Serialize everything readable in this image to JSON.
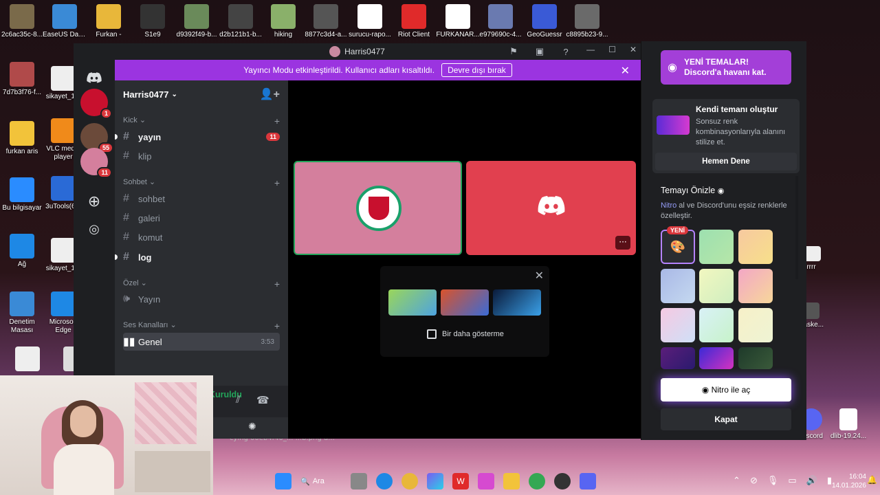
{
  "desktop": {
    "icons_top": [
      {
        "label": "2c6ac35c-8..."
      },
      {
        "label": "EaseUS Data Recovery"
      },
      {
        "label": "Furkan -"
      },
      {
        "label": "S1e9"
      },
      {
        "label": "d9392f49-b..."
      },
      {
        "label": "d2b121b1-b..."
      },
      {
        "label": "hiking"
      },
      {
        "label": "8877c3d4-a..."
      },
      {
        "label": "surucu-rapo..."
      },
      {
        "label": "Riot Client"
      },
      {
        "label": "FURKANAR..."
      },
      {
        "label": "e979690c-4..."
      },
      {
        "label": "GeoGuessr"
      },
      {
        "label": "c8895b23-9..."
      }
    ],
    "icons_left": [
      {
        "label": "7d7b3f76-f..."
      },
      {
        "label": "sikayet_1..."
      },
      {
        "label": "furkan aris"
      },
      {
        "label": "VLC media player"
      },
      {
        "label": "Bu bilgisayar"
      },
      {
        "label": "3uTools(6..."
      },
      {
        "label": "Ağ"
      },
      {
        "label": "sikayet_1..."
      },
      {
        "label": "Denetim Masası"
      },
      {
        "label": "Microsoft Edge"
      }
    ],
    "icons_right": [
      {
        "label": "rrrr"
      },
      {
        "label": "Baske..."
      },
      {
        "label": "Discord"
      },
      {
        "label": "dlib-19.24..."
      }
    ],
    "partial_labels": "cying          00eb4f40_...        ...b.png         d..."
  },
  "discord": {
    "window_title": "Harris0477",
    "notice": {
      "text": "Yayıncı Modu etkinleştirildi. Kullanıcı adları kısaltıldı.",
      "button": "Devre dışı bırak"
    },
    "guild_badges": [
      "1",
      "55",
      "11"
    ],
    "server_name": "Harris0477",
    "categories": {
      "kick": "Kick",
      "sohbet": "Sohbet",
      "ozel": "Özel",
      "ses": "Ses Kanalları"
    },
    "channels": {
      "yayin": "yayın",
      "yayin_mentions": "11",
      "klip": "klip",
      "sohbet": "sohbet",
      "galeri": "galeri",
      "komut": "komut",
      "log": "log",
      "yayin_voice": "Yayın",
      "genel": "Genel",
      "genel_time": "3:53"
    },
    "voice": {
      "status": "Ses Bağlantısı Kuruldu",
      "location": "Genel / Harris0477"
    },
    "activity": {
      "dont_show": "Bir daha gösterme"
    }
  },
  "theme_panel": {
    "promo_line1": "YENİ TEMALAR!",
    "promo_line2": "Discord'a havanı kat.",
    "create_title": "Kendi temanı oluştur",
    "create_desc": "Sonsuz renk kombinasyonlarıyla alanını stilize et.",
    "try_button": "Hemen Dene",
    "preview_title": "Temayı Önizle",
    "preview_nitro": "Nitro",
    "preview_desc": " al ve Discord'unu eşsiz renklerle özelleştir.",
    "new_tag": "YENİ",
    "unlock_button": "Nitro ile aç",
    "close_button": "Kapat",
    "swatches": [
      "linear-gradient(135deg,#9de0b0,#b6e6a8)",
      "linear-gradient(135deg,#f7c9a0,#f7e08a)",
      "linear-gradient(135deg,#a9b8e6,#c5d9f0)",
      "linear-gradient(135deg,#f2f7c0,#cfeec0)",
      "linear-gradient(135deg,#f3a7c6,#f7d79a)",
      "linear-gradient(135deg,#f6c9e2,#cfe0f7)",
      "linear-gradient(135deg,#d9f1f7,#c7f3c9)",
      "linear-gradient(135deg,#f7f0c8,#eef4d4)",
      "linear-gradient(135deg,#5b1e7a,#2a1a6e)",
      "linear-gradient(135deg,#3a2ad6,#d632c0)",
      "linear-gradient(135deg,#1e3a2a,#3a5a3a)"
    ]
  },
  "taskbar": {
    "search_label": "Ara",
    "time": "16:04",
    "date": "14.01.2026"
  }
}
